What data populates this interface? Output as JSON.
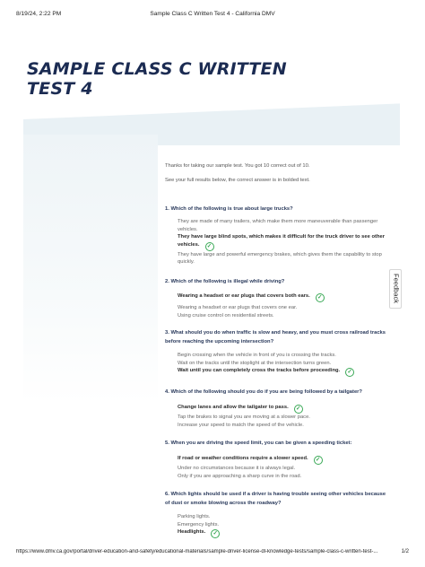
{
  "print_header": {
    "datetime": "8/19/24, 2:22 PM",
    "doc_title": "Sample Class C Written Test 4 - California DMV"
  },
  "page_title": "SAMPLE CLASS C WRITTEN TEST 4",
  "feedback_label": "Feedback",
  "intro": {
    "score_line": "Thanks for taking our sample test. You got 10 correct out of 10.",
    "results_line": "See your full results below, the correct answer is in bolded text."
  },
  "questions": [
    {
      "text": "1. Which of the following is true about large trucks?",
      "options": [
        "They are made of many trailers, which make them more maneuverable than passenger vehicles.",
        "They have large blind spots, which makes it difficult for the truck driver to see other vehicles.",
        "They have large and powerful emergency brakes, which gives them the capability to stop quickly."
      ],
      "correct": 1
    },
    {
      "text": "2. Which of the following is illegal while driving?",
      "options": [
        "Wearing a headset or ear plugs that covers both ears.",
        "Wearing a headset or ear plugs that covers one ear.",
        "Using cruise control on residential streets."
      ],
      "correct": 0
    },
    {
      "text": "3. What should you do when traffic is slow and heavy, and you must cross railroad tracks before reaching the upcoming intersection?",
      "options": [
        "Begin crossing when the vehicle in front of you is crossing the tracks.",
        "Wait on the tracks until the stoplight at the intersection turns green.",
        "Wait until you can completely cross the tracks before proceeding."
      ],
      "correct": 2
    },
    {
      "text": "4. Which of the following should you do if you are being followed by a tailgater?",
      "options": [
        "Change lanes and allow the tailgater to pass.",
        "Tap the brakes to signal you are moving at a slower pace.",
        "Increase your speed to match the speed of the vehicle."
      ],
      "correct": 0
    },
    {
      "text": "5. When you are driving the speed limit, you can be given a speeding ticket:",
      "options": [
        "If road or weather conditions require a slower speed.",
        "Under no circumstances because it is always legal.",
        "Only if you are approaching a sharp curve in the road."
      ],
      "correct": 0
    },
    {
      "text": "6. Which lights should be used if a driver is having trouble seeing other vehicles because of dust or smoke blowing across the roadway?",
      "options": [
        "Parking lights.",
        "Emergency lights.",
        "Headlights."
      ],
      "correct": 2
    }
  ],
  "print_footer": {
    "url": "https://www.dmv.ca.gov/portal/driver-education-and-safety/educational-materials/sample-driver-license-dl-knowledge-tests/sample-class-c-written-test-...",
    "page": "1/2"
  },
  "colors": {
    "title": "#1b2b52",
    "question": "#2a3a5c",
    "check": "#3aa956",
    "band": "#e9f1f5"
  },
  "icons": {
    "correct_marker": "check-circle-icon"
  }
}
